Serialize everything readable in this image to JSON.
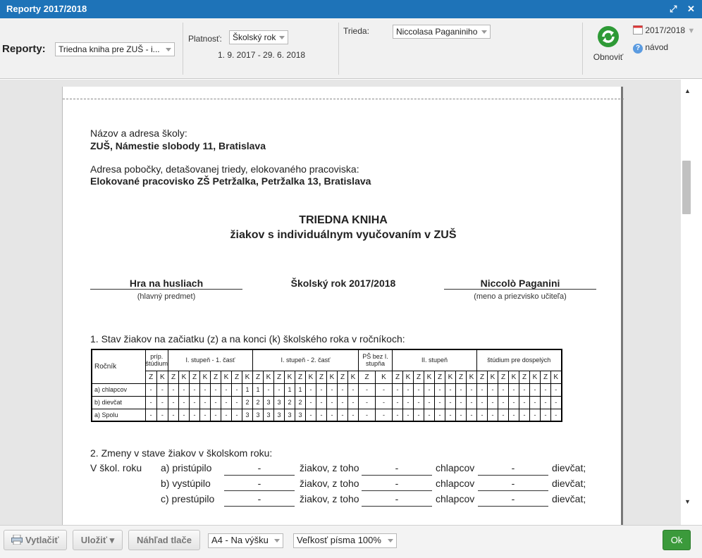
{
  "window": {
    "title": "Reporty 2017/2018"
  },
  "toolbar": {
    "reporty_label": "Reporty:",
    "report_select": "Triedna kniha pre ZUŠ - i...",
    "platnost_label": "Platnosť:",
    "platnost_select": "Školský rok",
    "date_range": "1. 9. 2017 - 29. 6. 2018",
    "trieda_label": "Trieda:",
    "trieda_select": "Niccolasa Paganiniho",
    "refresh_label": "Obnoviť",
    "year_label": "2017/2018",
    "help_label": "návod"
  },
  "document": {
    "school_label": "Názov a adresa školy:",
    "school_value": "ZUŠ, Námestie slobody 11, Bratislava",
    "branch_label": "Adresa pobočky, detašovanej triedy, elokovaného pracoviska:",
    "branch_value": "Elokované pracovisko ZŠ Petržalka, Petržalka 13, Bratislava",
    "title1": "TRIEDNA KNIHA",
    "title2": "žiakov s individuálnym vyučovaním v ZUŠ",
    "subject": "Hra na husliach",
    "subject_caption": "(hlavný predmet)",
    "school_year": "Školský rok 2017/2018",
    "teacher": "Niccolò Paganini",
    "teacher_caption": "(meno a priezvisko učiteľa)",
    "section1": "1. Stav žiakov na začiatku (z) a na konci (k) školského roka v ročníkoch:",
    "table": {
      "rocnik": "Ročník",
      "groups": [
        "príp. štúdium",
        "I. stupeň - 1. časť",
        "I. stupeň - 2. časť",
        "PŠ bez I. stupňa",
        "II. stupeň",
        "štúdium pre dospelých"
      ],
      "group_cols": [
        2,
        8,
        10,
        2,
        8,
        8
      ],
      "rows": [
        {
          "label": "a) chlapcov",
          "cells": [
            "-",
            "-",
            "-",
            "-",
            "-",
            "-",
            "-",
            "-",
            "-",
            "1",
            "1",
            "-",
            "-",
            "1",
            "1",
            "-",
            "-",
            "-",
            "-",
            "-",
            "-",
            "-",
            "-",
            "-",
            "-",
            "-",
            "-",
            "-",
            "-",
            "-",
            "-",
            "-",
            "-",
            "-",
            "-",
            "-",
            "-",
            "-"
          ]
        },
        {
          "label": "b) dievčat",
          "cells": [
            "-",
            "-",
            "-",
            "-",
            "-",
            "-",
            "-",
            "-",
            "-",
            "2",
            "2",
            "3",
            "3",
            "2",
            "2",
            "-",
            "-",
            "-",
            "-",
            "-",
            "-",
            "-",
            "-",
            "-",
            "-",
            "-",
            "-",
            "-",
            "-",
            "-",
            "-",
            "-",
            "-",
            "-",
            "-",
            "-",
            "-",
            "-"
          ]
        },
        {
          "label": "a) Spolu",
          "cells": [
            "-",
            "-",
            "-",
            "-",
            "-",
            "-",
            "-",
            "-",
            "-",
            "3",
            "3",
            "3",
            "3",
            "3",
            "3",
            "-",
            "-",
            "-",
            "-",
            "-",
            "-",
            "-",
            "-",
            "-",
            "-",
            "-",
            "-",
            "-",
            "-",
            "-",
            "-",
            "-",
            "-",
            "-",
            "-",
            "-",
            "-",
            "-"
          ]
        }
      ]
    },
    "section2": "2. Zmeny v stave žiakov v školskom roku:",
    "v_skol_roku": "V škol. roku",
    "changes": [
      {
        "label": "a) pristúpilo",
        "v1": "-",
        "mid": "žiakov, z toho",
        "v2": "-",
        "t2": "chlapcov",
        "v3": "-",
        "t3": "dievčat;"
      },
      {
        "label": "b) vystúpilo",
        "v1": "-",
        "mid": "žiakov, z toho",
        "v2": "-",
        "t2": "chlapcov",
        "v3": "-",
        "t3": "dievčat;"
      },
      {
        "label": "c) prestúpilo",
        "v1": "-",
        "mid": "žiakov, z toho",
        "v2": "-",
        "t2": "chlapcov",
        "v3": "-",
        "t3": "dievčat;"
      }
    ]
  },
  "footer": {
    "print": "Vytlačiť",
    "save": "Uložiť ▾",
    "preview": "Náhľad tlače",
    "paper_select": "A4 - Na výšku",
    "font_select": "Veľkosť písma 100%",
    "ok": "Ok"
  }
}
